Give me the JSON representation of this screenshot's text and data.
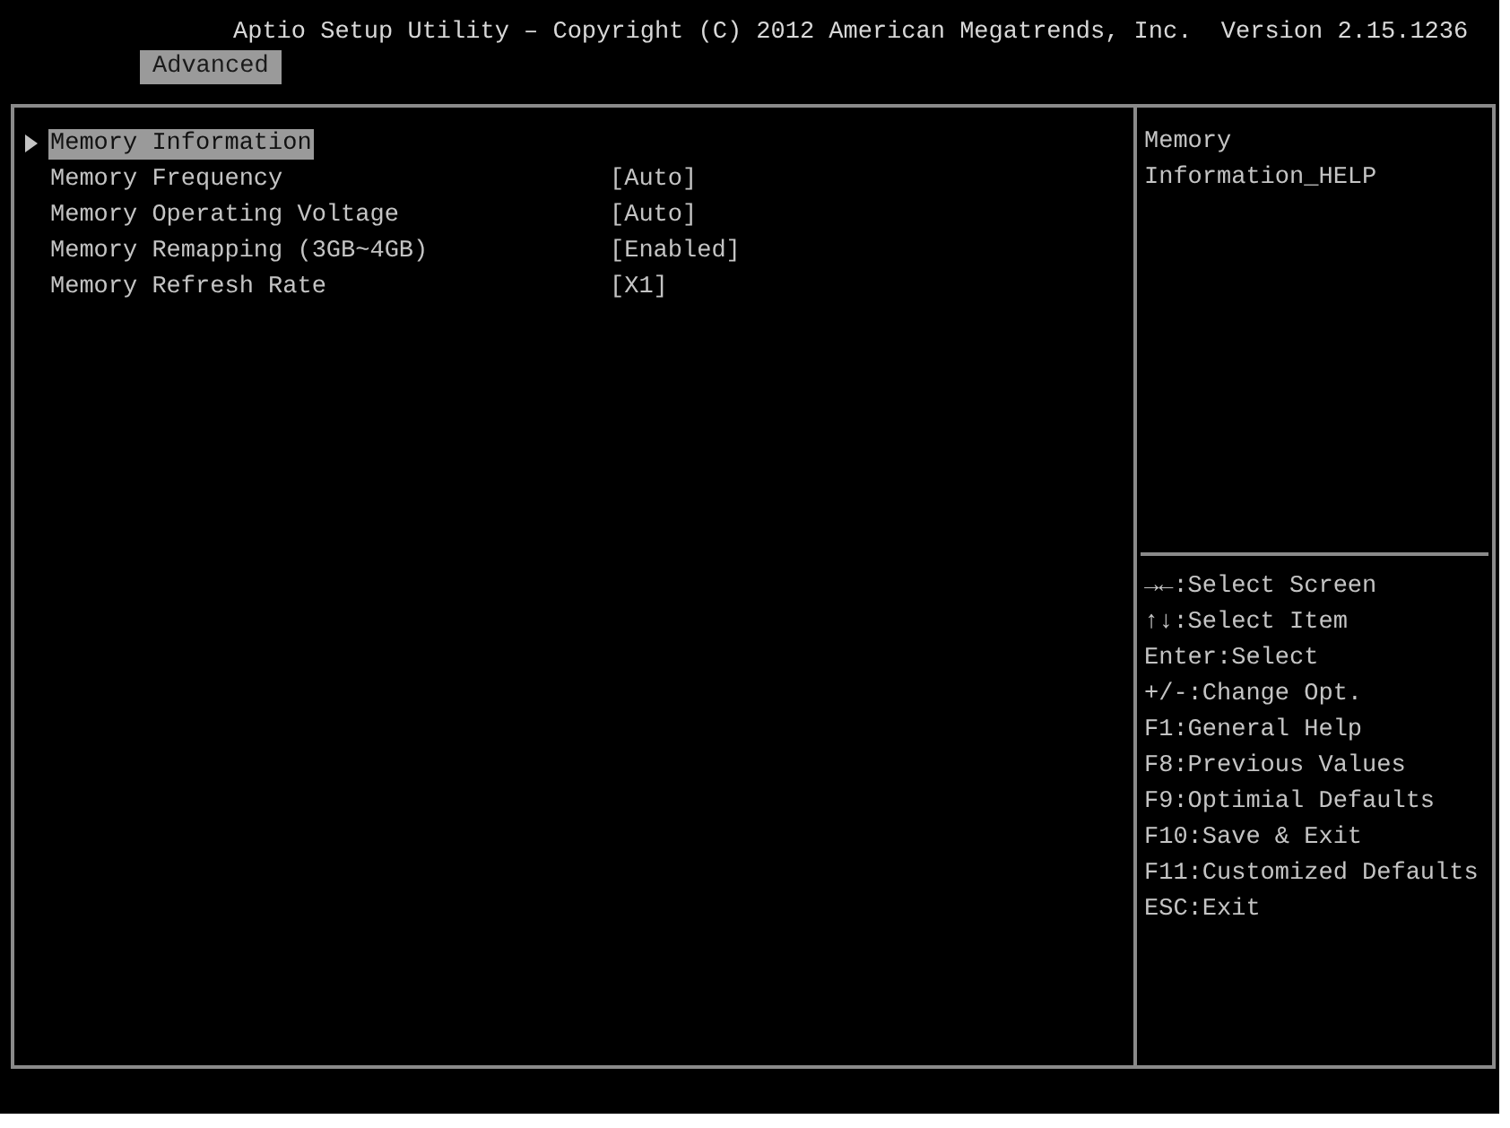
{
  "header": {
    "title": "Aptio Setup Utility – Copyright (C) 2012 American Megatrends, Inc.  Version 2.15.1236",
    "tabs": [
      {
        "label": "Advanced",
        "selected": true
      }
    ]
  },
  "menu": {
    "items": [
      {
        "kind": "submenu",
        "label": "Memory Information",
        "selected": true
      },
      {
        "kind": "option",
        "label": "Memory Frequency",
        "value": "[Auto]",
        "selected": false
      },
      {
        "kind": "option",
        "label": "Memory Operating Voltage",
        "value": "[Auto]",
        "selected": false
      },
      {
        "kind": "option",
        "label": "Memory Remapping (3GB~4GB)",
        "value": "[Enabled]",
        "selected": false
      },
      {
        "kind": "option",
        "label": "Memory Refresh Rate",
        "value": "[X1]",
        "selected": false
      }
    ]
  },
  "help": {
    "text": "Memory Information_HELP",
    "keys": [
      "→←:Select Screen",
      "↑↓:Select Item",
      "Enter:Select",
      "+/-:Change Opt.",
      "F1:General Help",
      "F8:Previous Values",
      "F9:Optimial Defaults",
      "F10:Save & Exit",
      "F11:Customized Defaults",
      "ESC:Exit"
    ]
  }
}
